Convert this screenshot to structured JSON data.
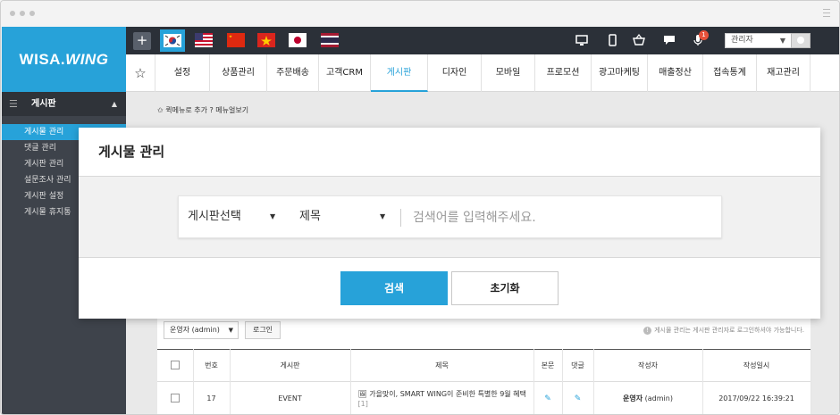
{
  "brand": {
    "logo_main": "WISA.",
    "logo_sub": "WING",
    "accent": "#27a2d9",
    "dark": "#2b3038"
  },
  "topbar": {
    "add_icon": "+",
    "flags": [
      {
        "name": "korea-flag-icon",
        "active": true
      },
      {
        "name": "usa-flag-icon"
      },
      {
        "name": "china-flag-icon"
      },
      {
        "name": "vietnam-flag-icon"
      },
      {
        "name": "japan-flag-icon"
      },
      {
        "name": "thailand-flag-icon"
      }
    ],
    "icons": [
      "desktop-icon",
      "mobile-icon",
      "basket-icon",
      "chat-icon",
      "microphone-icon"
    ],
    "notification_count": "1",
    "user_select": "관리자"
  },
  "nav": {
    "items": [
      "설정",
      "상품관리",
      "주문배송",
      "고객CRM",
      "게시판",
      "디자인",
      "모바일",
      "프로모션",
      "광고마케팅",
      "매출정산",
      "접속통계",
      "재고관리"
    ],
    "active": "게시판"
  },
  "sidebar": {
    "title": "게시판",
    "items": [
      "게시물 관리",
      "댓글 관리",
      "게시판 관리",
      "설문조사 관리",
      "게시판 설정",
      "게시물 휴지통"
    ],
    "active_index": 0
  },
  "quickmenu": {
    "add": "퀵메뉴로 추가",
    "help": "메뉴얼보기"
  },
  "board": {
    "admin_select": "운영자 (admin)",
    "login_button": "로그인",
    "notice": "게시물 관리는 게시판 관리자로 로그인하셔야 가능합니다.",
    "columns": [
      "번호",
      "게시판",
      "제목",
      "본문",
      "댓글",
      "작성자",
      "작성일시"
    ],
    "rows": [
      {
        "no": "17",
        "board": "EVENT",
        "title": "가을맞이, SMART WING이 준비한 특별한 9월 혜택",
        "comments": "[1]",
        "author": "운영자",
        "author_id": "(admin)",
        "date": "2017/09/22 16:39:21"
      }
    ]
  },
  "modal": {
    "title": "게시물 관리",
    "board_select": "게시판선택",
    "field_select": "제목",
    "search_placeholder": "검색어를 입력해주세요.",
    "search_button": "검색",
    "reset_button": "초기화"
  }
}
